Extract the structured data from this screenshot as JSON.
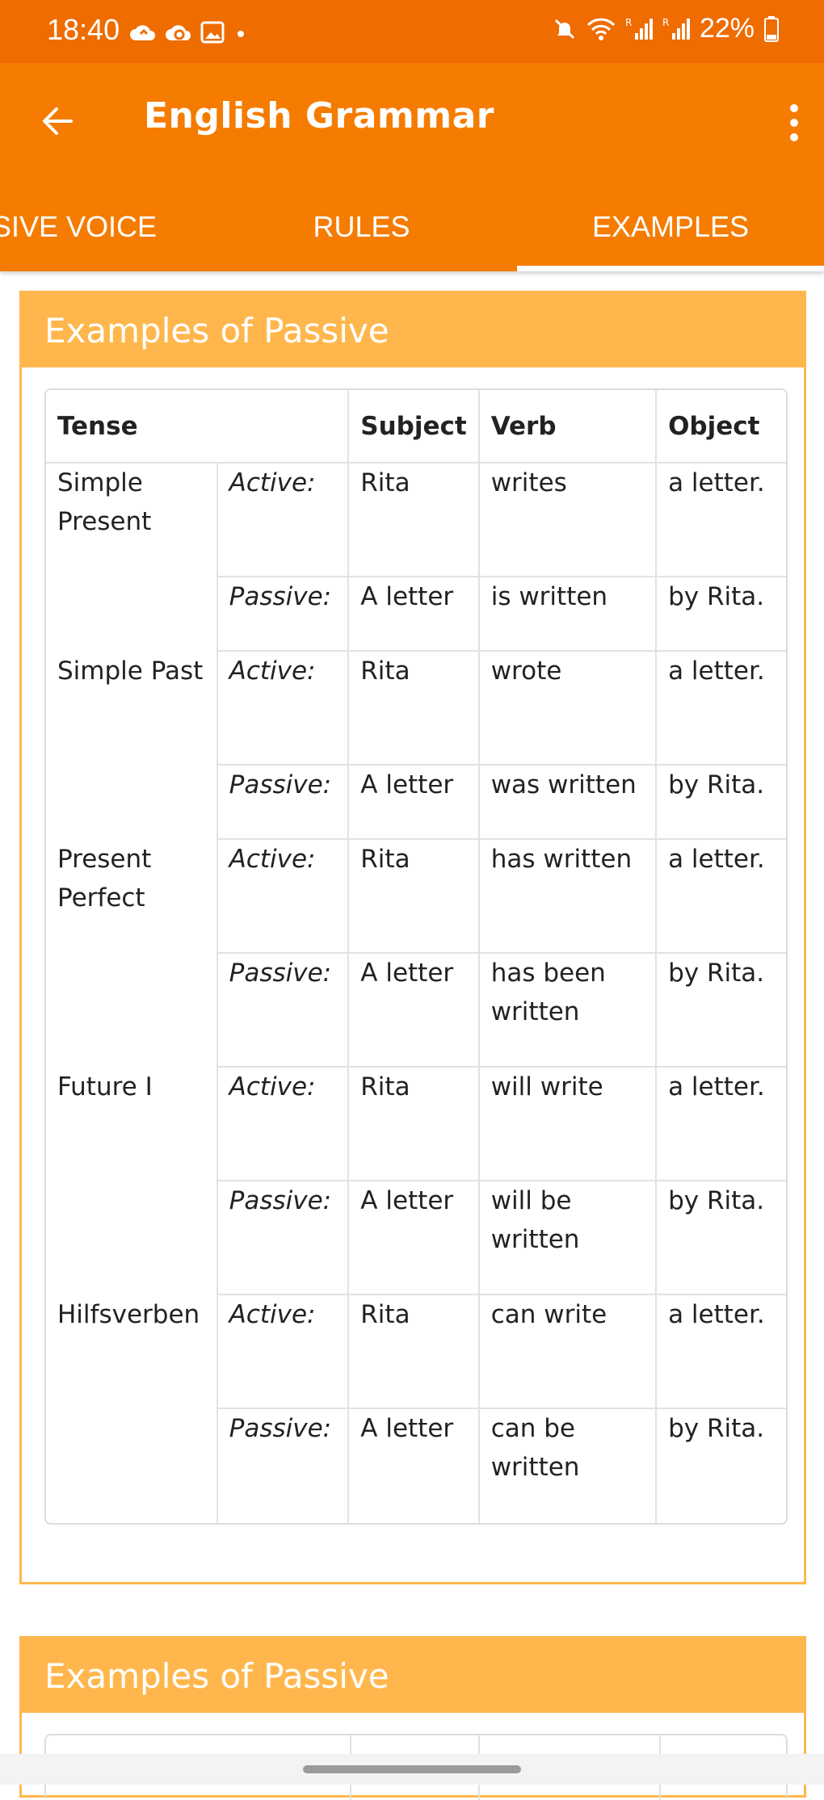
{
  "status_bar": {
    "time": "18:40",
    "battery": "22%",
    "icons_left": [
      "cloud-icon",
      "cloud-sync-icon",
      "gallery-icon",
      "dot-icon"
    ],
    "icons_right": [
      "mute-icon",
      "wifi-icon",
      "signal-icon",
      "signal-icon",
      "battery-icon"
    ]
  },
  "app_bar": {
    "title": "English Grammar",
    "back_icon": "arrow-back-icon",
    "more_icon": "more-vert-icon",
    "color": "#f57c00"
  },
  "tabs": [
    {
      "label": "SIVE VOICE"
    },
    {
      "label": "RULES"
    },
    {
      "label": "EXAMPLES",
      "selected": true
    }
  ],
  "card": {
    "title": "Examples of Passive",
    "header_color": "#ffb74d",
    "table": {
      "headers": [
        "Tense",
        "Subject",
        "Verb",
        "Object"
      ],
      "rows": [
        {
          "tense": "Simple Present",
          "active": {
            "voice": "Active:",
            "subject": "Rita",
            "verb": "writes",
            "object": "a letter."
          },
          "passive": {
            "voice": "Passive:",
            "subject": "A letter",
            "verb": "is written",
            "object": "by Rita."
          }
        },
        {
          "tense": "Simple Past",
          "active": {
            "voice": "Active:",
            "subject": "Rita",
            "verb": "wrote",
            "object": "a letter."
          },
          "passive": {
            "voice": "Passive:",
            "subject": "A letter",
            "verb": "was written",
            "object": "by Rita."
          }
        },
        {
          "tense": "Present Perfect",
          "active": {
            "voice": "Active:",
            "subject": "Rita",
            "verb": "has written",
            "object": "a letter."
          },
          "passive": {
            "voice": "Passive:",
            "subject": "A letter",
            "verb": "has been written",
            "object": "by Rita."
          }
        },
        {
          "tense": "Future I",
          "active": {
            "voice": "Active:",
            "subject": "Rita",
            "verb": "will write",
            "object": "a letter."
          },
          "passive": {
            "voice": "Passive:",
            "subject": "A letter",
            "verb": "will be written",
            "object": "by Rita."
          }
        },
        {
          "tense": "Hilfsverben",
          "active": {
            "voice": "Active:",
            "subject": "Rita",
            "verb": "can write",
            "object": "a letter."
          },
          "passive": {
            "voice": "Passive:",
            "subject": "A letter",
            "verb": "can be written",
            "object": "by Rita."
          }
        }
      ]
    }
  },
  "card2": {
    "title": "Examples of Passive"
  }
}
